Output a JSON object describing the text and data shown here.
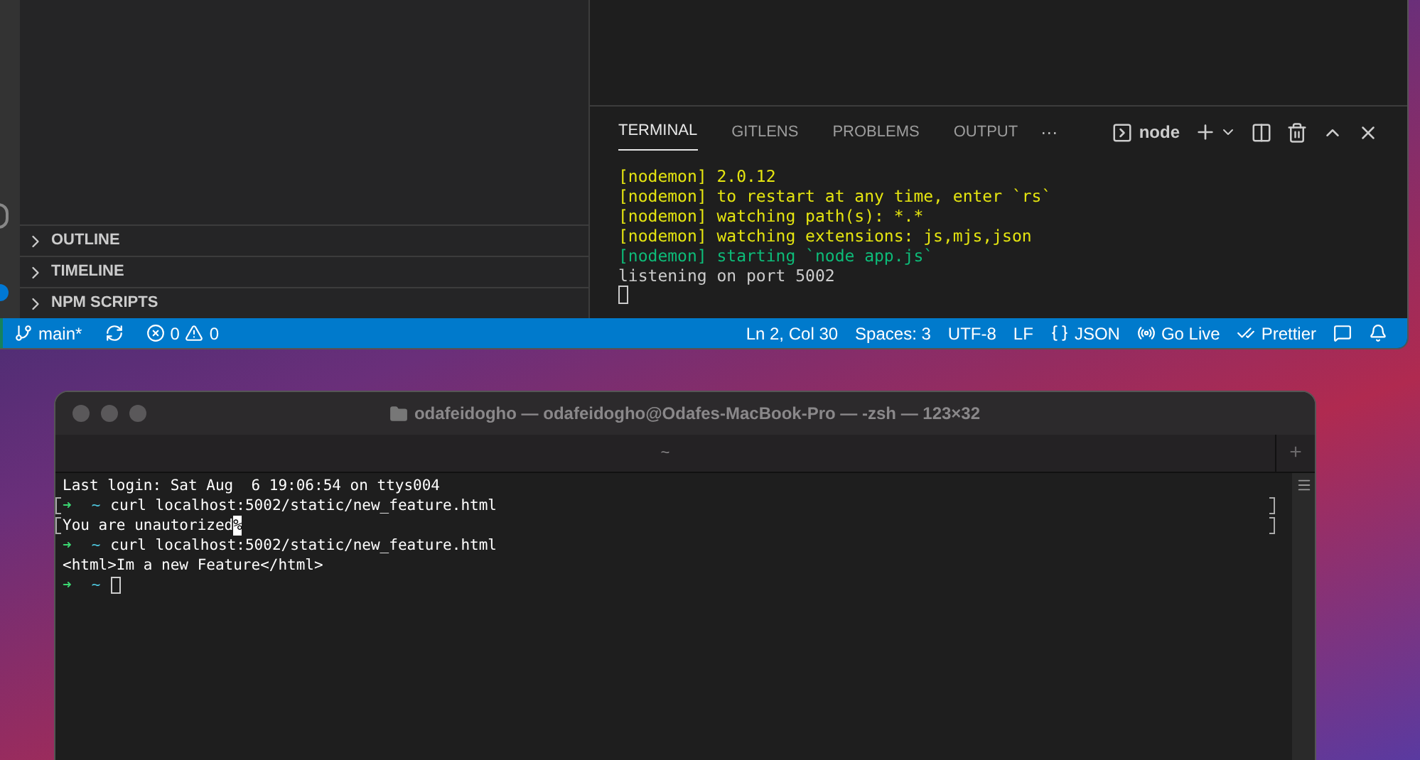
{
  "sidebar": {
    "sections": [
      {
        "label": "OUTLINE",
        "expanded": false
      },
      {
        "label": "TIMELINE",
        "expanded": false
      },
      {
        "label": "NPM SCRIPTS",
        "expanded": false
      }
    ]
  },
  "panel": {
    "tabs": [
      {
        "label": "TERMINAL",
        "selected": true
      },
      {
        "label": "GITLENS",
        "selected": false
      },
      {
        "label": "PROBLEMS",
        "selected": false
      },
      {
        "label": "OUTPUT",
        "selected": false
      }
    ],
    "more": "···",
    "terminal_name": "node",
    "lines": [
      {
        "tag": "[nodemon]",
        "text": "2.0.12",
        "color": "#e5e510"
      },
      {
        "tag": "[nodemon]",
        "text": "to restart at any time, enter `rs`",
        "color": "#e5e510"
      },
      {
        "tag": "[nodemon]",
        "text": "watching path(s): *.*",
        "color": "#e5e510"
      },
      {
        "tag": "[nodemon]",
        "text": "watching extensions: js,mjs,json",
        "color": "#e5e510"
      },
      {
        "tag": "[nodemon]",
        "text": "starting `node app.js`",
        "color": "#0dbc79"
      },
      {
        "text": "listening on port 5002",
        "color": "#cccccc"
      }
    ]
  },
  "status_bar": {
    "branch": "main*",
    "errors": "0",
    "warnings": "0",
    "right": [
      {
        "kind": "text",
        "label": "Ln 2, Col 30"
      },
      {
        "kind": "text",
        "label": "Spaces: 3"
      },
      {
        "kind": "text",
        "label": "UTF-8"
      },
      {
        "kind": "text",
        "label": "LF"
      },
      {
        "kind": "braces",
        "label": "JSON"
      },
      {
        "kind": "live",
        "label": "Go Live"
      },
      {
        "kind": "check",
        "label": "Prettier"
      },
      {
        "kind": "feedback"
      },
      {
        "kind": "bell"
      }
    ]
  },
  "terminal_window": {
    "title": "odafeidogho — odafeidogho@Odafes-MacBook-Pro — -zsh — 123×32",
    "tab": "~",
    "new_tab": "+",
    "lines": [
      {
        "kind": "output",
        "text": "Last login: Sat Aug  6 19:06:54 on ttys004",
        "marked": false
      },
      {
        "kind": "prompt",
        "arrow": "➜",
        "dir": "~",
        "text": "curl localhost:5002/static/new_feature.html",
        "marked": true
      },
      {
        "kind": "output",
        "text": "You are unautorized",
        "end": "%",
        "marked": true
      },
      {
        "kind": "prompt",
        "arrow": "➜",
        "dir": "~",
        "text": "curl localhost:5002/static/new_feature.html",
        "marked": false
      },
      {
        "kind": "output",
        "text": "<html>Im a new Feature</html>",
        "marked": false
      },
      {
        "kind": "prompt",
        "arrow": "➜",
        "dir": "~",
        "cursor": true,
        "marked": false
      }
    ]
  }
}
